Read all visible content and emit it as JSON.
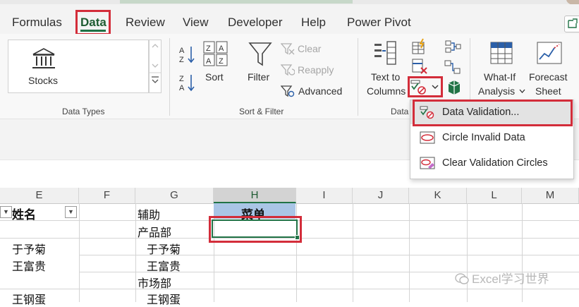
{
  "tabs": [
    {
      "label": "Formulas"
    },
    {
      "label": "Data"
    },
    {
      "label": "Review"
    },
    {
      "label": "View"
    },
    {
      "label": "Developer"
    },
    {
      "label": "Help"
    },
    {
      "label": "Power Pivot"
    }
  ],
  "ribbon": {
    "data_types": {
      "stocks_label": "Stocks",
      "group_label": "Data Types"
    },
    "sort_filter": {
      "sort_label": "Sort",
      "filter_label": "Filter",
      "clear_label": "Clear",
      "reapply_label": "Reapply",
      "advanced_label": "Advanced",
      "group_label": "Sort & Filter"
    },
    "data_tools": {
      "text_to_columns_line1": "Text to",
      "text_to_columns_line2": "Columns",
      "group_label": "Data"
    },
    "forecast": {
      "whatif_line1": "What-If",
      "whatif_line2": "Analysis",
      "forecast_line1": "Forecast",
      "forecast_line2": "Sheet"
    }
  },
  "menu": {
    "items": [
      {
        "label": "Data Validation..."
      },
      {
        "label": "Circle Invalid Data"
      },
      {
        "label": "Clear Validation Circles"
      }
    ]
  },
  "grid": {
    "columns": [
      "E",
      "F",
      "G",
      "H",
      "I",
      "J",
      "K",
      "L",
      "M"
    ],
    "selected_column": "H",
    "cells": {
      "e_header": "姓名",
      "g_header": "辅助",
      "h_header": "菜单",
      "e1": "于予菊",
      "e2": "王富贵",
      "e3": "王钢蛋",
      "g1": "产品部",
      "g2": "于予菊",
      "g3": "王富贵",
      "g4": "市场部",
      "g5": "王钢蛋"
    }
  },
  "watermark": "Excel学习世界",
  "colors": {
    "accent_green": "#217346",
    "highlight_red": "#d32d3a",
    "header_blue": "#a9c5e6"
  }
}
